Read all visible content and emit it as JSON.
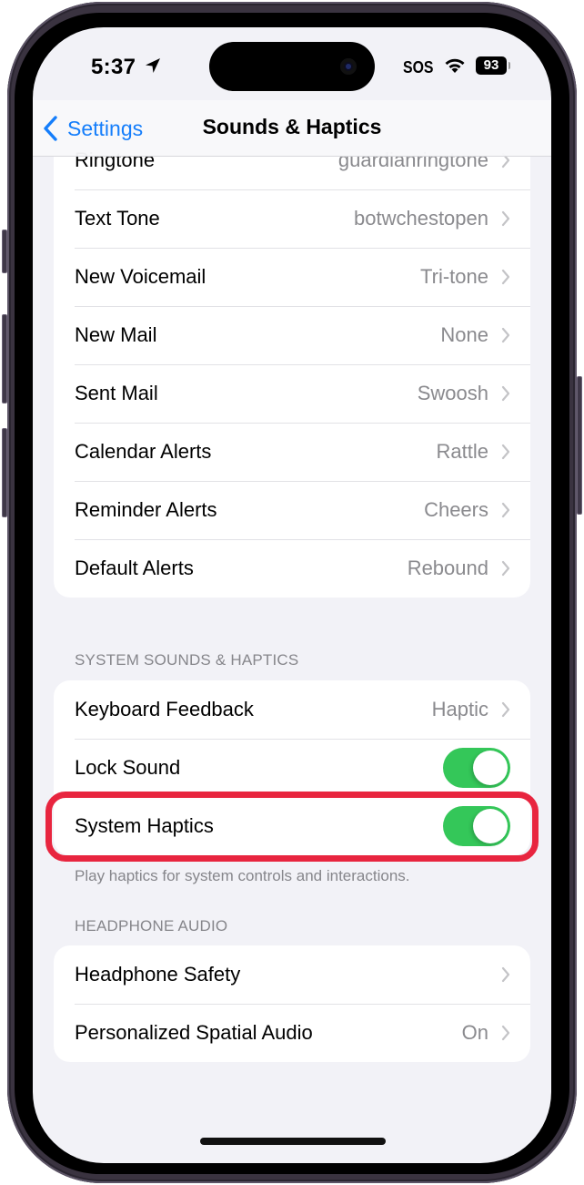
{
  "status_bar": {
    "time": "5:37",
    "location_icon": "location-arrow-icon",
    "carrier": "SOS",
    "wifi_icon": "wifi-icon",
    "battery_level": "93"
  },
  "navbar": {
    "back_label": "Settings",
    "back_icon": "chevron-left-icon",
    "title": "Sounds & Haptics"
  },
  "sounds_group": {
    "rows": [
      {
        "label": "Ringtone",
        "value": "guardianringtone"
      },
      {
        "label": "Text Tone",
        "value": "botwchestopen"
      },
      {
        "label": "New Voicemail",
        "value": "Tri-tone"
      },
      {
        "label": "New Mail",
        "value": "None"
      },
      {
        "label": "Sent Mail",
        "value": "Swoosh"
      },
      {
        "label": "Calendar Alerts",
        "value": "Rattle"
      },
      {
        "label": "Reminder Alerts",
        "value": "Cheers"
      },
      {
        "label": "Default Alerts",
        "value": "Rebound"
      }
    ]
  },
  "system_section": {
    "header": "SYSTEM SOUNDS & HAPTICS",
    "keyboard_feedback": {
      "label": "Keyboard Feedback",
      "value": "Haptic"
    },
    "lock_sound": {
      "label": "Lock Sound",
      "on": true
    },
    "system_haptics": {
      "label": "System Haptics",
      "on": true
    },
    "footer": "Play haptics for system controls and interactions."
  },
  "headphone_section": {
    "header": "HEADPHONE AUDIO",
    "rows": [
      {
        "label": "Headphone Safety",
        "value": ""
      },
      {
        "label": "Personalized Spatial Audio",
        "value": "On"
      }
    ]
  },
  "colors": {
    "accent": "#157efb",
    "toggle_on": "#34c759",
    "highlight": "#e8253f",
    "background": "#f2f2f7"
  }
}
